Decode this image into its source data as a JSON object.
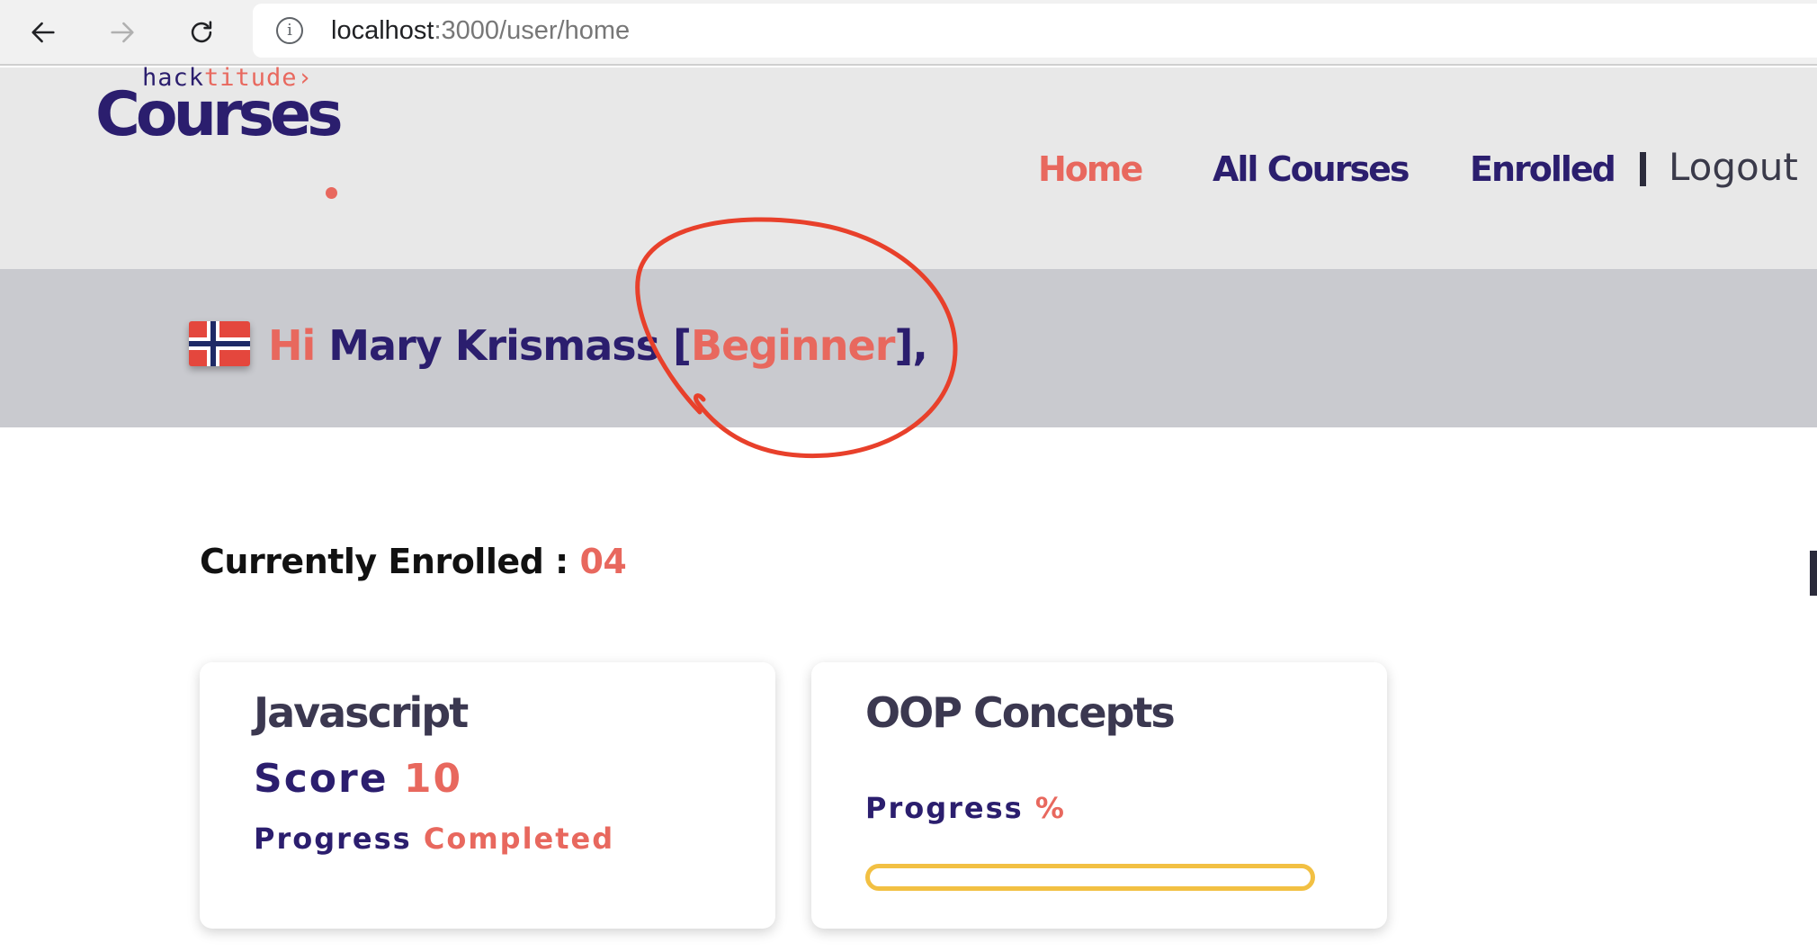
{
  "browser": {
    "url_host": "localhost",
    "url_path": ":3000/user/home",
    "back_icon": "arrow-left-icon",
    "forward_icon": "arrow-right-icon",
    "reload_icon": "reload-icon",
    "info_icon": "info-icon",
    "info_glyph": "i"
  },
  "logo": {
    "top_hack": "hack",
    "top_titude": "titude›",
    "main": "Courses"
  },
  "nav": {
    "home": "Home",
    "all_courses": "All Courses",
    "enrolled": "Enrolled",
    "logout": "Logout"
  },
  "greeting": {
    "hi": "Hi",
    "name": "Mary Krismass",
    "open_bracket": "[",
    "level": "Beginner",
    "close_bracket": "],",
    "flag_icon": "norway-flag-icon"
  },
  "enrolled": {
    "label": "Currently Enrolled :",
    "count": "04"
  },
  "courses": [
    {
      "title": "Javascript",
      "score_label": "Score",
      "score_value": "10",
      "progress_label": "Progress",
      "progress_value": "Completed"
    },
    {
      "title": "OOP Concepts",
      "progress_label": "Progress",
      "progress_value": "%",
      "progress_fraction": 0
    }
  ],
  "colors": {
    "brand_navy": "#2b1e6e",
    "brand_coral": "#e8685e",
    "progress_yellow": "#f2c043",
    "annotation_red": "#e8402b"
  }
}
